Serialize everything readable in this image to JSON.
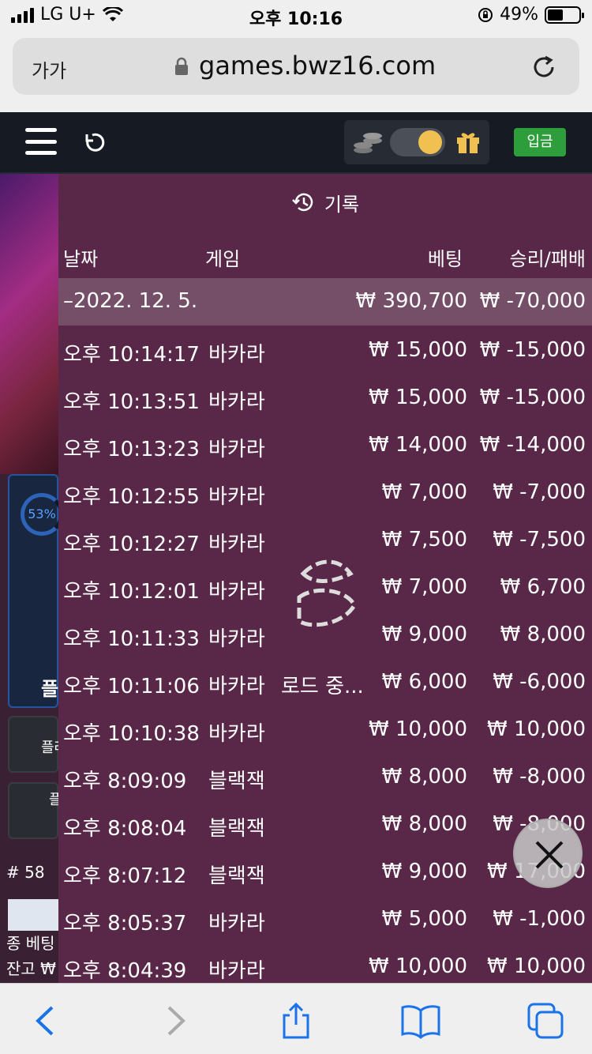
{
  "status": {
    "carrier": "LG U+",
    "time": "오후 10:16",
    "battery": "49%"
  },
  "browser": {
    "text_size_label": "가가",
    "url": "games.bwz16.com"
  },
  "site": {
    "deposit_label": "입금",
    "toggle_colors": {
      "knob": "#f0c050",
      "deposit": "#2e9e3d"
    }
  },
  "background": {
    "progress_label": "53%",
    "text_1": "플",
    "text_2": "플레이어 페어",
    "text_3": "플",
    "text_4": "# 58",
    "text_5": "종 베팅",
    "text_6": "잔고 ₩"
  },
  "history": {
    "title": "기록",
    "columns": {
      "date": "날짜",
      "game": "게임",
      "bet": "베팅",
      "result": "승리/패배"
    },
    "date_group": {
      "date": "–2022. 12. 5.",
      "bet": "₩ 390,700",
      "result": "₩ -70,000"
    },
    "rows": [
      {
        "time": "오후 10:14:17",
        "game": "바카라",
        "bet": "₩ 15,000",
        "result": "₩ -15,000"
      },
      {
        "time": "오후 10:13:51",
        "game": "바카라",
        "bet": "₩ 15,000",
        "result": "₩ -15,000"
      },
      {
        "time": "오후 10:13:23",
        "game": "바카라",
        "bet": "₩ 14,000",
        "result": "₩ -14,000"
      },
      {
        "time": "오후 10:12:55",
        "game": "바카라",
        "bet": "₩ 7,000",
        "result": "₩ -7,000"
      },
      {
        "time": "오후 10:12:27",
        "game": "바카라",
        "bet": "₩ 7,500",
        "result": "₩ -7,500"
      },
      {
        "time": "오후 10:12:01",
        "game": "바카라",
        "bet": "₩ 7,000",
        "result": "₩ 6,700"
      },
      {
        "time": "오후 10:11:33",
        "game": "바카라",
        "bet": "₩ 9,000",
        "result": "₩ 8,000"
      },
      {
        "time": "오후 10:11:06",
        "game": "바카라",
        "bet": "₩ 6,000",
        "result": "₩ -6,000"
      },
      {
        "time": "오후 10:10:38",
        "game": "바카라",
        "bet": "₩ 10,000",
        "result": "₩ 10,000"
      },
      {
        "time": "오후 8:09:09",
        "game": "블랙잭",
        "bet": "₩ 8,000",
        "result": "₩ -8,000"
      },
      {
        "time": "오후 8:08:04",
        "game": "블랙잭",
        "bet": "₩ 8,000",
        "result": "₩ -8,000"
      },
      {
        "time": "오후 8:07:12",
        "game": "블랙잭",
        "bet": "₩ 9,000",
        "result": "₩ 17,000"
      },
      {
        "time": "오후 8:05:37",
        "game": "바카라",
        "bet": "₩ 5,000",
        "result": "₩ -1,000"
      },
      {
        "time": "오후 8:04:39",
        "game": "바카라",
        "bet": "₩ 10,000",
        "result": "₩ 10,000"
      }
    ],
    "loading_text": "로드 중..."
  },
  "icons": {
    "lock": "lock-icon",
    "reload": "reload-icon",
    "menu": "hamburger-icon",
    "refresh": "refresh-icon",
    "coins": "coins-icon",
    "gift": "gift-icon",
    "history": "history-icon",
    "close": "close-icon",
    "back": "back-icon",
    "forward": "forward-icon",
    "share": "share-icon",
    "bookmarks": "book-icon",
    "tabs": "tabs-icon"
  }
}
